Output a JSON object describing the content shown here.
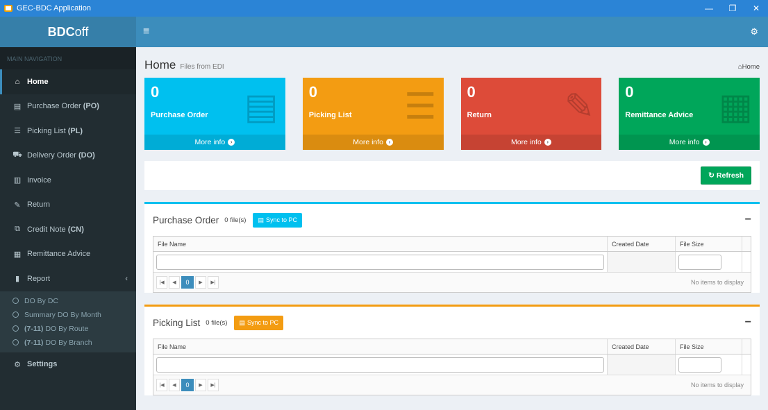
{
  "window": {
    "title": "GEC-BDC Application",
    "minimize": "—",
    "restore": "❐",
    "close": "✕"
  },
  "brand": {
    "bold": "BDC",
    "rest": "off"
  },
  "sidebar": {
    "header": "MAIN NAVIGATION",
    "items": [
      {
        "icon": "home-icon",
        "glyph": "⌂",
        "label": "Home",
        "suffix": ""
      },
      {
        "icon": "file-icon",
        "glyph": "▤",
        "label": "Purchase Order ",
        "suffix": "(PO)"
      },
      {
        "icon": "list-icon",
        "glyph": "☰",
        "label": "Picking List ",
        "suffix": "(PL)"
      },
      {
        "icon": "truck-icon",
        "glyph": "⛟",
        "label": "Delivery Order ",
        "suffix": "(DO)"
      },
      {
        "icon": "bank-icon",
        "glyph": "▥",
        "label": "Invoice",
        "suffix": ""
      },
      {
        "icon": "edit-icon",
        "glyph": "✎",
        "label": "Return",
        "suffix": ""
      },
      {
        "icon": "copy-icon",
        "glyph": "⧉",
        "label": "Credit Note ",
        "suffix": "(CN)"
      },
      {
        "icon": "calendar-icon",
        "glyph": "▦",
        "label": "Remittance Advice",
        "suffix": ""
      },
      {
        "icon": "bar-chart-icon",
        "glyph": "▮",
        "label": "Report",
        "suffix": ""
      }
    ],
    "report_caret": "‹",
    "report_sub": [
      {
        "prefix": "",
        "label": "DO By DC"
      },
      {
        "prefix": "",
        "label": "Summary DO By Month"
      },
      {
        "prefix": "(7-11)",
        "label": "DO By Route"
      },
      {
        "prefix": "(7-11)",
        "label": "DO By Branch"
      }
    ],
    "settings": {
      "icon": "cogs-icon",
      "glyph": "⚙",
      "label": "Settings"
    }
  },
  "topbar": {
    "menu_glyph": "≡",
    "settings_glyph": "⚙"
  },
  "page": {
    "title": "Home",
    "subtitle": "Files from EDI",
    "breadcrumb": "⌂Home"
  },
  "tiles": [
    {
      "value": "0",
      "label": "Purchase Order",
      "more": "More info",
      "color": "#00c0ef",
      "icon": "file-icon"
    },
    {
      "value": "0",
      "label": "Picking List",
      "more": "More info",
      "color": "#f39c12",
      "icon": "list-icon"
    },
    {
      "value": "0",
      "label": "Return",
      "more": "More info",
      "color": "#dd4b39",
      "icon": "edit-icon"
    },
    {
      "value": "0",
      "label": "Remittance Advice",
      "more": "More info",
      "color": "#00a65a",
      "icon": "calendar-icon"
    }
  ],
  "refresh_label": "Refresh",
  "panels": [
    {
      "title": "Purchase Order",
      "count": "0 file(s)",
      "sync": "Sync to PC",
      "columns": [
        "File Name",
        "Created Date",
        "File Size"
      ],
      "current_page": "0",
      "empty": "No items to display"
    },
    {
      "title": "Picking List",
      "count": "0 file(s)",
      "sync": "Sync to PC",
      "columns": [
        "File Name",
        "Created Date",
        "File Size"
      ],
      "current_page": "0",
      "empty": "No items to display"
    }
  ]
}
